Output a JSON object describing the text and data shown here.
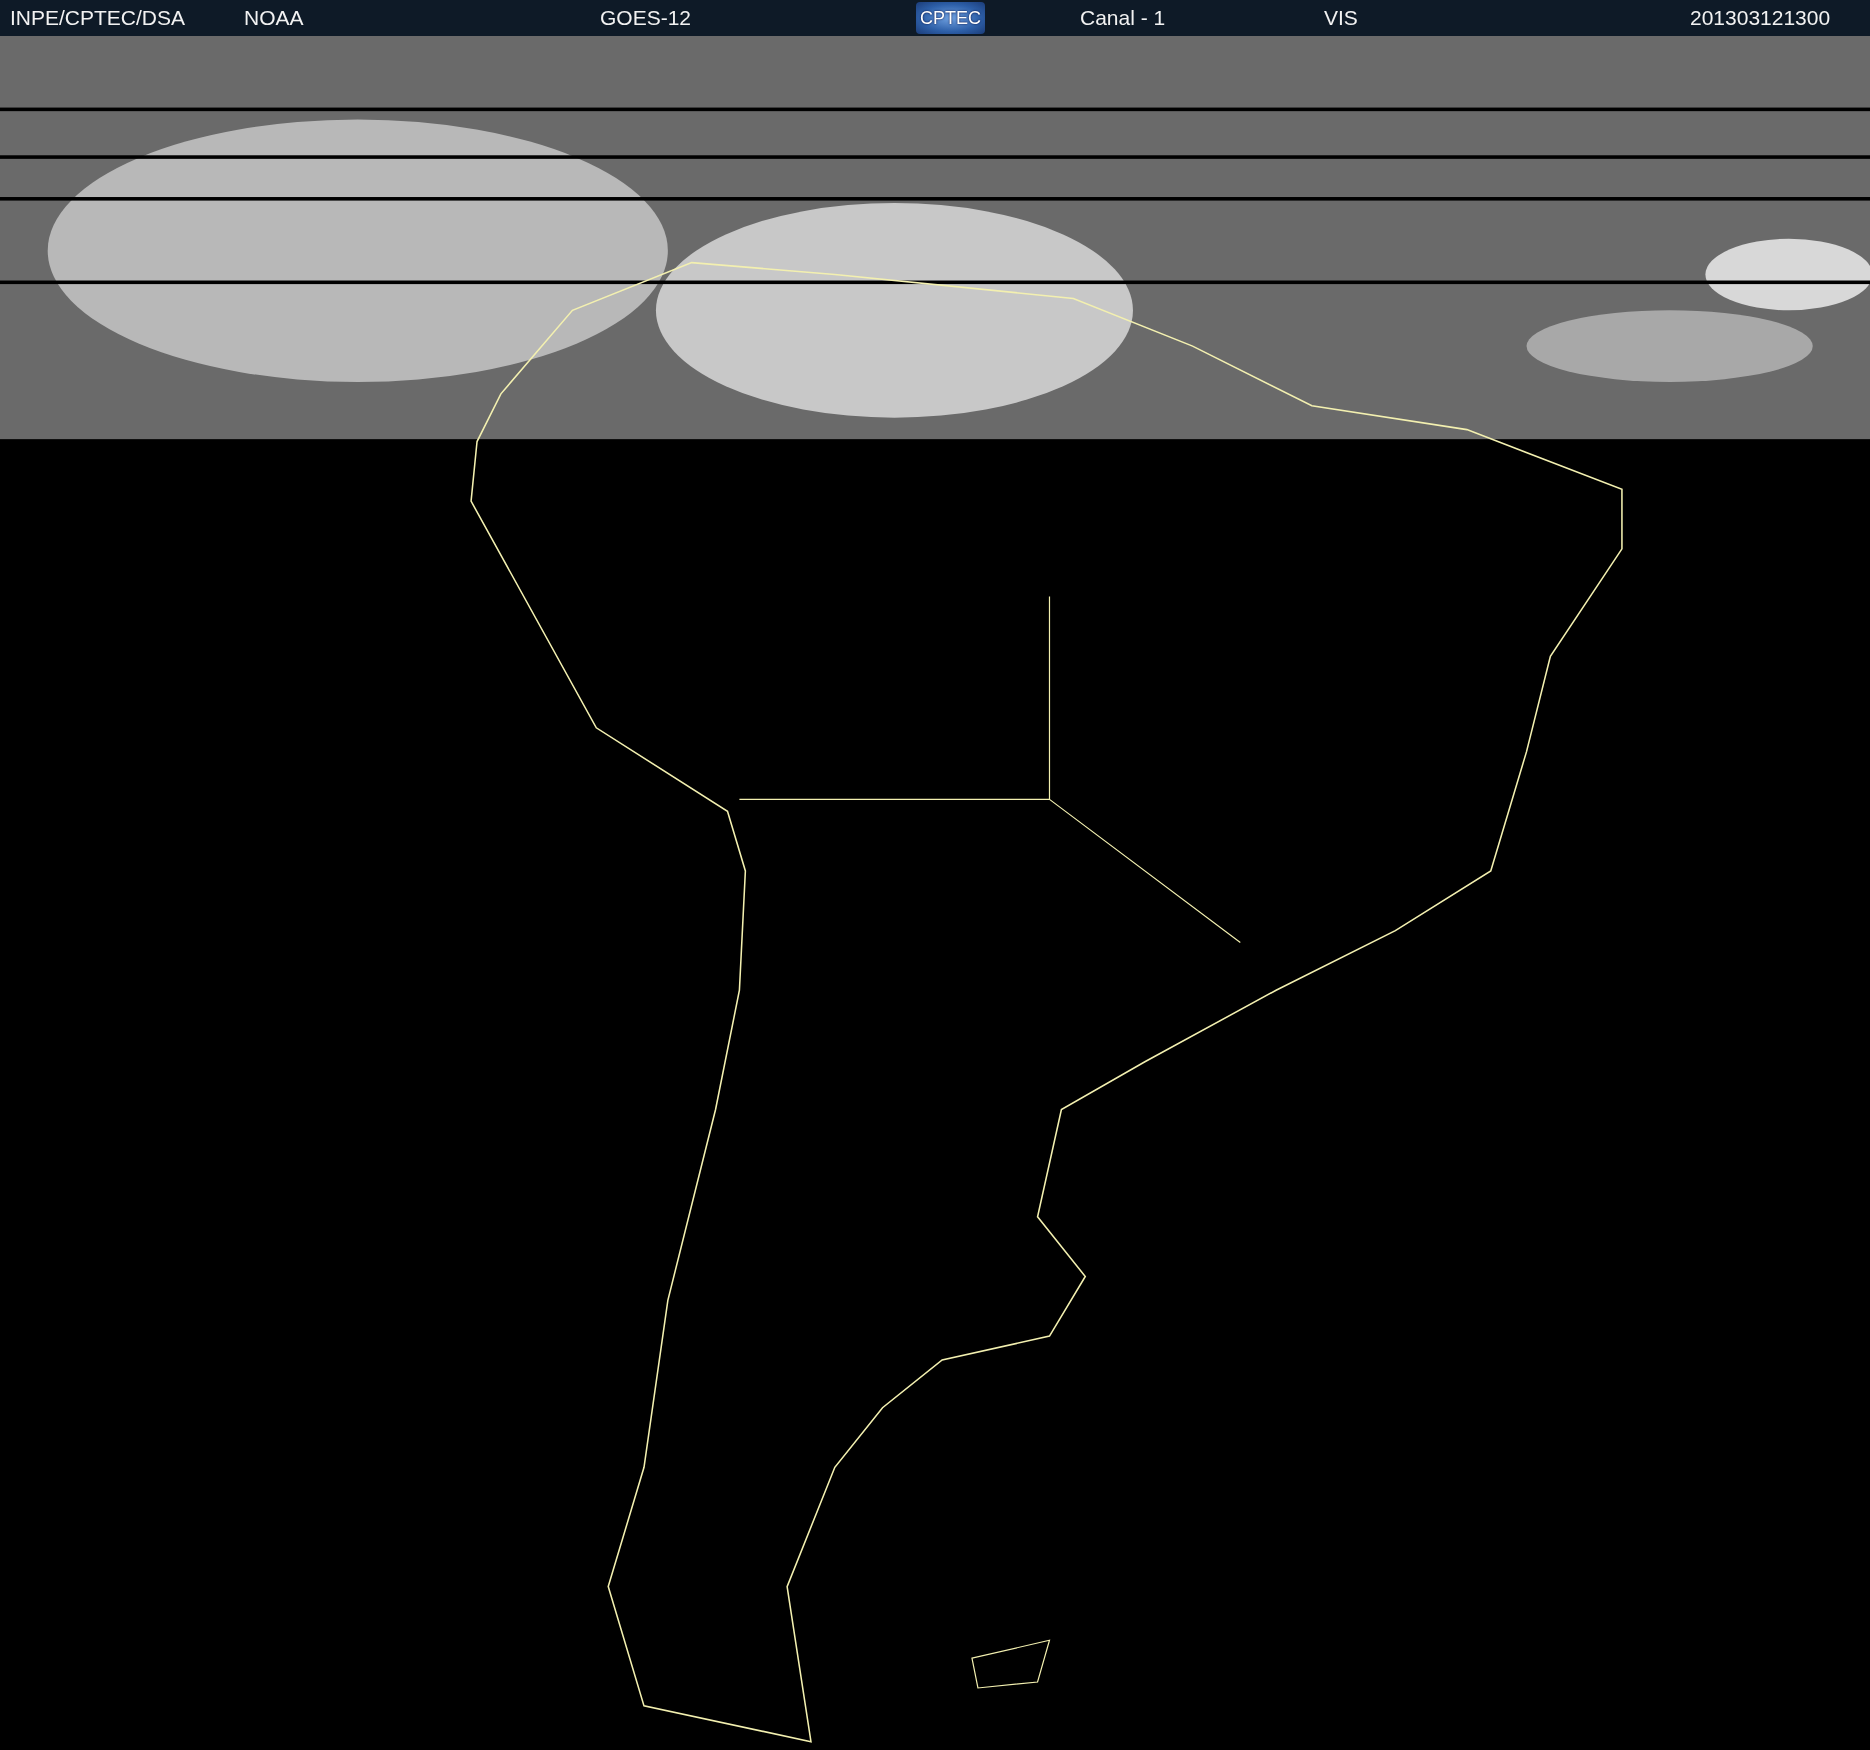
{
  "header": {
    "items": [
      {
        "kind": "text",
        "text": "INPE/CPTEC/DSA"
      },
      {
        "kind": "text",
        "text": "NOAA"
      },
      {
        "kind": "text",
        "text": "GOES-12"
      },
      {
        "kind": "logo",
        "text": "CPTEC"
      },
      {
        "kind": "text",
        "text": "Canal - 1"
      },
      {
        "kind": "text",
        "text": "VIS"
      },
      {
        "kind": "text",
        "text": "201303121300"
      }
    ]
  }
}
